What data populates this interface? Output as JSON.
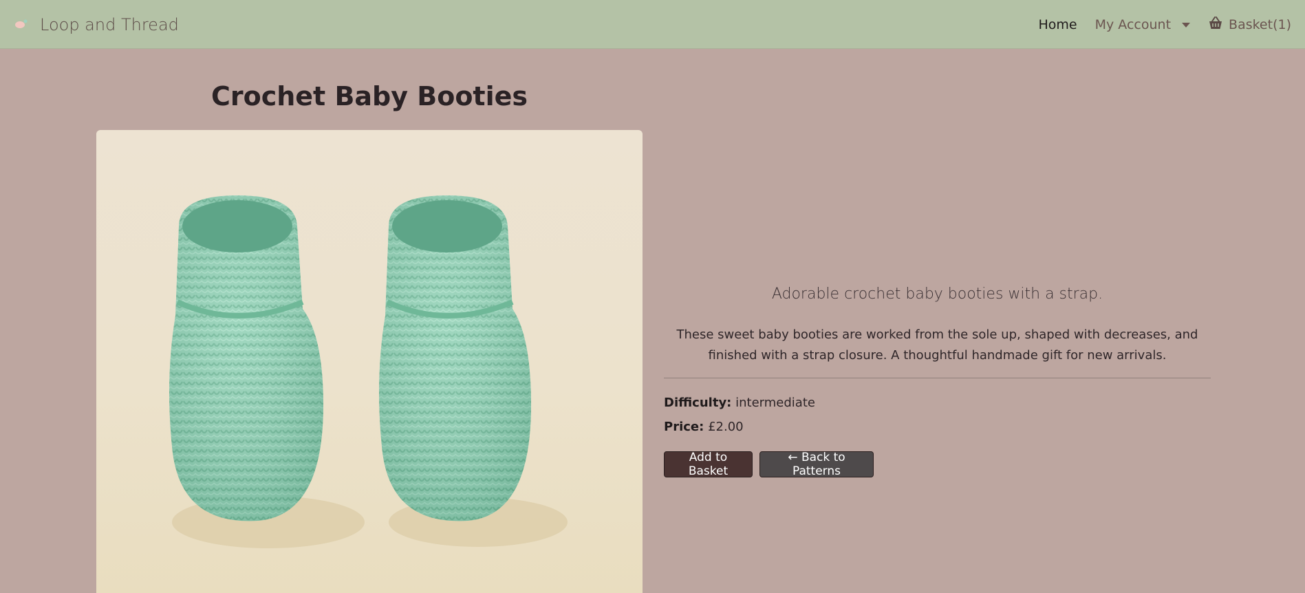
{
  "nav": {
    "brand": "Loop and Thread",
    "home": "Home",
    "account": "My Account",
    "basket": "Basket(1)"
  },
  "product": {
    "title": "Crochet Baby Booties",
    "tagline": "Adorable crochet baby booties with a strap.",
    "description": "These sweet baby booties are worked from the sole up, shaped with decreases, and finished with a strap closure. A thoughtful handmade gift for new arrivals.",
    "difficulty_label": "Difficulty:",
    "difficulty": "intermediate",
    "price_label": "Price:",
    "price": "£2.00"
  },
  "actions": {
    "add_to_basket": "Add to Basket",
    "back": "← Back to Patterns"
  },
  "icons": {
    "brand_logo": "yarn-ball-icon",
    "account_caret": "caret-down-icon",
    "basket": "shopping-basket-icon"
  },
  "colors": {
    "page_bg": "#bda6a0",
    "navbar_bg": "#b4c2a6",
    "booties": "#8fd0b4",
    "add_button": "#4a3332",
    "back_button": "#4e4a4b"
  }
}
